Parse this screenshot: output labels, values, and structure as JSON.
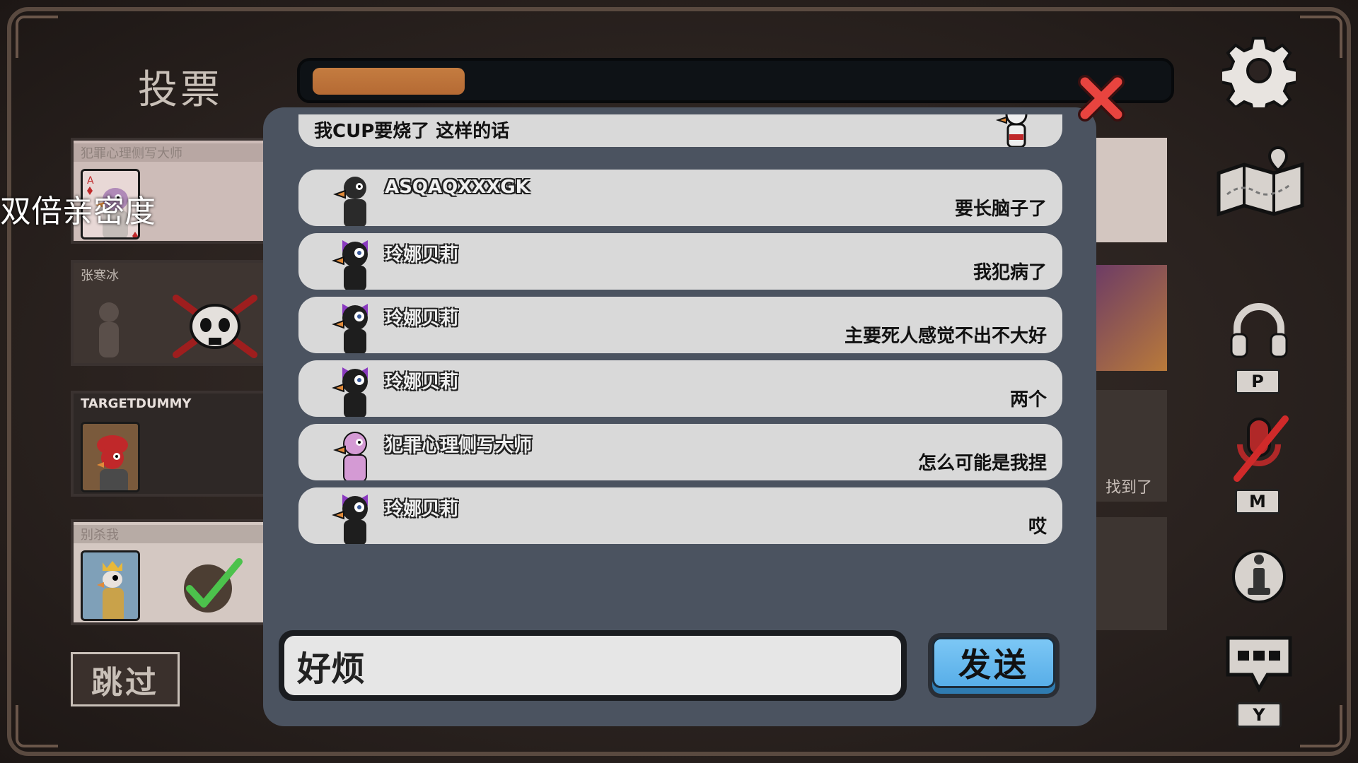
{
  "screen_title": "投票",
  "timer": {
    "fraction_remaining": 0.18,
    "fill_color": "#b56a34"
  },
  "overlay_caption": "双倍亲密度",
  "players": [
    {
      "name": "犯罪心理侧写大师",
      "avatar": "pink-goose-card"
    },
    {
      "name": "张寒冰",
      "avatar": "dead-goose-skull",
      "status": "dead"
    },
    {
      "name": "TARGETDUMMY",
      "avatar": "red-hat-duck"
    },
    {
      "name": "别杀我",
      "avatar": "crowned-goose",
      "status": "voted"
    }
  ],
  "skip_label": "跳过",
  "right_cards": {
    "found_label": "找到了"
  },
  "side_controls": {
    "settings_icon": "gear-icon",
    "map_icon": "map-icon",
    "voice_key": "P",
    "mute_key": "M",
    "chat_key": "Y"
  },
  "chat": {
    "messages": [
      {
        "sender": "",
        "text": "我CUP要烧了 这样的话",
        "avatar": "goose-white"
      },
      {
        "sender": "ASQAQXXXGK",
        "text": "要长脑子了",
        "avatar": "goose-black"
      },
      {
        "sender": "玲娜贝莉",
        "text": "我犯病了",
        "avatar": "goose-purple-bow"
      },
      {
        "sender": "玲娜贝莉",
        "text": "主要死人感觉不出不大好",
        "avatar": "goose-purple-bow"
      },
      {
        "sender": "玲娜贝莉",
        "text": "两个",
        "avatar": "goose-purple-bow"
      },
      {
        "sender": "犯罪心理侧写大师",
        "text": "怎么可能是我捏",
        "avatar": "goose-pink"
      },
      {
        "sender": "玲娜贝莉",
        "text": "哎",
        "avatar": "goose-purple-bow"
      }
    ],
    "input_value": "好烦",
    "send_label": "发送"
  },
  "colors": {
    "panel": "#4b5360",
    "bubble": "#d9d9d9",
    "send_button": "#6bbcf0",
    "close_x": "#e8443f"
  }
}
